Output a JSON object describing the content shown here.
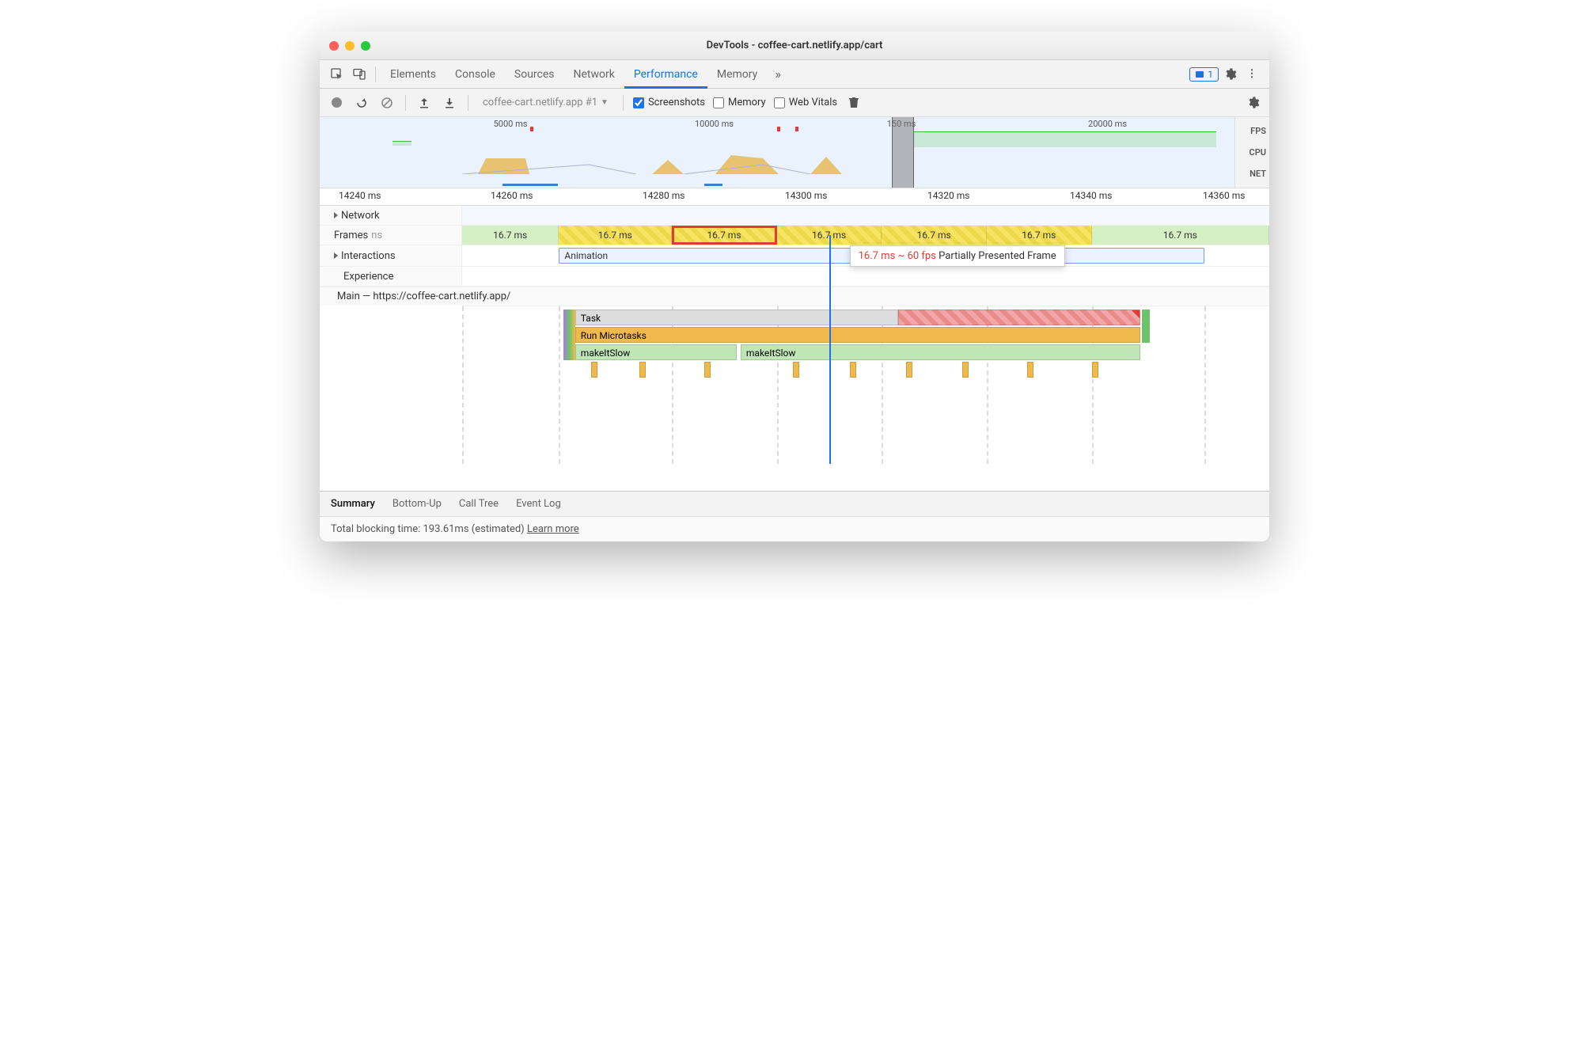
{
  "window": {
    "title": "DevTools - coffee-cart.netlify.app/cart"
  },
  "tabs": {
    "items": [
      "Elements",
      "Console",
      "Sources",
      "Network",
      "Performance",
      "Memory"
    ],
    "active": "Performance",
    "badge_count": "1"
  },
  "toolbar": {
    "recording_select": "coffee-cart.netlify.app #1",
    "cb_screenshots": "Screenshots",
    "cb_memory": "Memory",
    "cb_webvitals": "Web Vitals"
  },
  "overview": {
    "ticks": [
      "5000 ms",
      "10000 ms",
      "150    ms",
      "20000 ms"
    ],
    "labels": [
      "FPS",
      "CPU",
      "NET"
    ]
  },
  "ruler": {
    "ticks": [
      "14240 ms",
      "14260 ms",
      "14280 ms",
      "14300 ms",
      "14320 ms",
      "14340 ms",
      "14360 ms"
    ]
  },
  "rows": {
    "network": "Network",
    "frames": "Frames",
    "frames_extra": "ns",
    "interactions": "Interactions",
    "experience": "Experience",
    "main": "Main — https://coffee-cart.netlify.app/"
  },
  "frames": {
    "items": [
      "16.7 ms",
      "16.7 ms",
      "16.7 ms",
      "16.7 ms",
      "16.7 ms",
      "16.7 ms",
      "16.7 ms"
    ]
  },
  "interactions": {
    "span": "Animation"
  },
  "tooltip": {
    "fps": "16.7 ms ~ 60 fps",
    "label": "Partially Presented Frame"
  },
  "flame": {
    "task": "Task",
    "microtasks": "Run Microtasks",
    "fn1": "makeItSlow",
    "fn2": "makeItSlow"
  },
  "bottom_tabs": {
    "items": [
      "Summary",
      "Bottom-Up",
      "Call Tree",
      "Event Log"
    ],
    "active": "Summary"
  },
  "footer": {
    "text": "Total blocking time: 193.61ms (estimated)",
    "link": "Learn more"
  }
}
